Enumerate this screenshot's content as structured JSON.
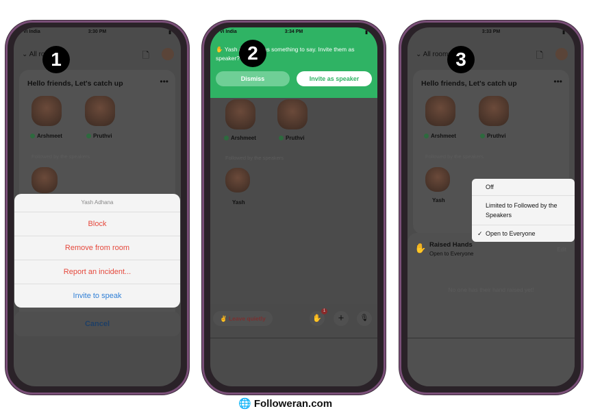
{
  "phones": [
    {
      "carrier": "Vi India",
      "time": "3:30 PM",
      "back_label": "All rooms",
      "step": "1",
      "room_title": "Hello friends, Let's catch up",
      "speakers": [
        "Arshmeet",
        "Pruthvi"
      ],
      "section": "Followed by the speakers",
      "action_sheet": {
        "title": "Yash Adhana",
        "items": [
          {
            "label": "Block",
            "color": "#e5483c"
          },
          {
            "label": "Remove from room",
            "color": "#e5483c"
          },
          {
            "label": "Report an incident...",
            "color": "#e5483c"
          },
          {
            "label": "Invite to speak",
            "color": "#2f7fd6"
          }
        ],
        "cancel": "Cancel"
      }
    },
    {
      "carrier": "Vi India",
      "time": "3:34 PM",
      "step": "2",
      "banner": {
        "text": "Yash Adhana has something to say. Invite them as speaker?",
        "dismiss": "Dismiss",
        "invite": "Invite as speaker",
        "color": "#2fb364"
      },
      "speakers": [
        "Arshmeet",
        "Pruthvi"
      ],
      "section": "Followed by the speakers",
      "listener": "Yash",
      "footer": {
        "leave": "Leave quietly",
        "badge": "1"
      }
    },
    {
      "carrier": "",
      "time": "3:33 PM",
      "back_label": "All rooms",
      "step": "3",
      "room_title": "Hello friends, Let's catch up",
      "speakers": [
        "Arshmeet",
        "Pruthvi"
      ],
      "section": "Followed by the speakers",
      "listener": "Yash",
      "menu": [
        {
          "label": "Off",
          "checked": false
        },
        {
          "label": "Limited to Followed by the Speakers",
          "checked": false
        },
        {
          "label": "Open to Everyone",
          "checked": true
        }
      ],
      "raised_hands": {
        "title": "Raised Hands",
        "subtitle": "Open to Everyone",
        "edit": "Edit",
        "empty": "No one has their hand raised yet!"
      }
    }
  ],
  "watermark": "Followeran.com"
}
